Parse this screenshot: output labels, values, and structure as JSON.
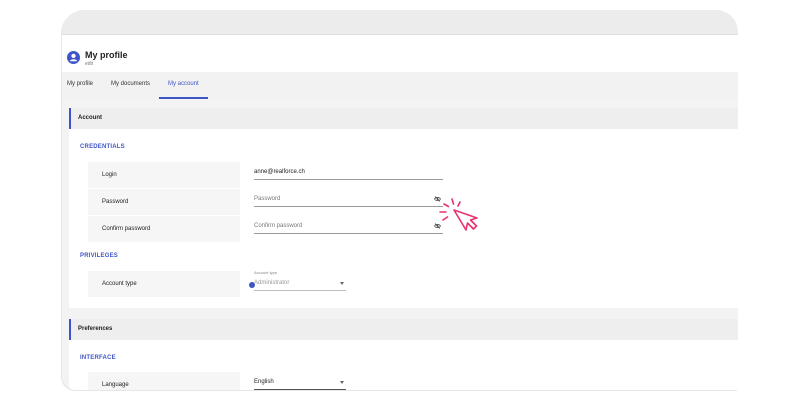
{
  "header": {
    "title": "My profile",
    "subtitle": "edit"
  },
  "tabs": [
    {
      "label": "My profile",
      "active": false
    },
    {
      "label": "My documents",
      "active": false
    },
    {
      "label": "My account",
      "active": true
    }
  ],
  "account": {
    "section_title": "Account",
    "credentials": {
      "group_title": "CREDENTIALS",
      "login": {
        "label": "Login",
        "value": "anne@realforce.ch"
      },
      "password": {
        "label": "Password",
        "placeholder": "Password"
      },
      "confirm_password": {
        "label": "Confirm password",
        "placeholder": "Confirm password"
      }
    },
    "privileges": {
      "group_title": "PRIVILEGES",
      "account_type": {
        "label": "Account type",
        "select_label": "Account type",
        "value": "Administrator"
      }
    }
  },
  "preferences": {
    "section_title": "Preferences",
    "interface": {
      "group_title": "INTERFACE",
      "language": {
        "label": "Language",
        "value": "English"
      }
    }
  },
  "colors": {
    "accent": "#3e55c8",
    "cursor": "#e8336d"
  },
  "icons": [
    "avatar-icon",
    "eye-off-icon",
    "info-icon",
    "chevron-down-icon",
    "pointer-click-icon"
  ]
}
